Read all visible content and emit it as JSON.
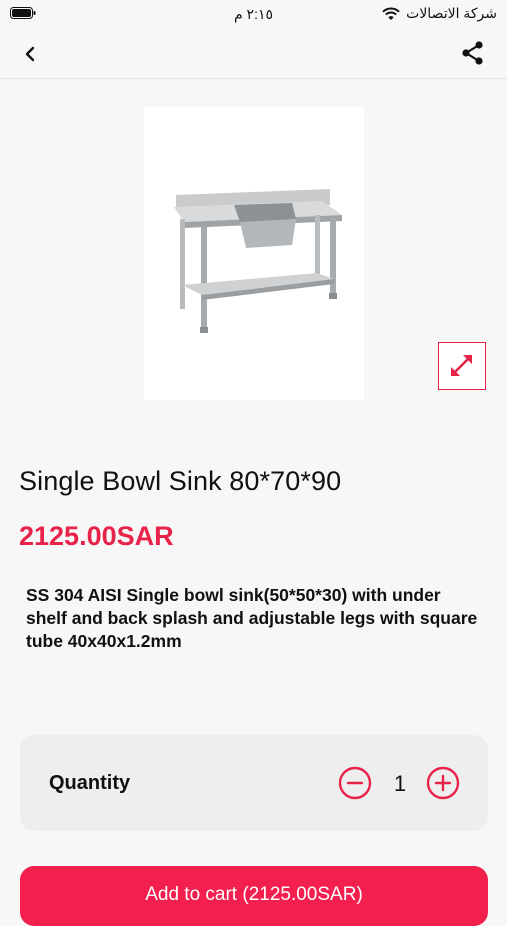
{
  "status_bar": {
    "carrier": "شركة الاتصالات",
    "time": "٢:١٥ م"
  },
  "app_bar": {
    "back_icon": "chevron-left-icon",
    "share_icon": "share-icon"
  },
  "product": {
    "image_alt": "stainless steel single bowl sink table",
    "title": "Single Bowl Sink 80*70*90",
    "price": "2125.00SAR",
    "description": "SS 304 AISI Single bowl sink(50*50*30) with under shelf and back splash and adjustable legs with square tube 40x40x1.2mm"
  },
  "quantity": {
    "label": "Quantity",
    "value": "1"
  },
  "cart_button": {
    "label": "Add to cart (2125.00SAR)"
  },
  "colors": {
    "accent": "#e8234a",
    "button": "#f21f4f",
    "background": "#f7f7f7",
    "card": "#eeeeee"
  }
}
